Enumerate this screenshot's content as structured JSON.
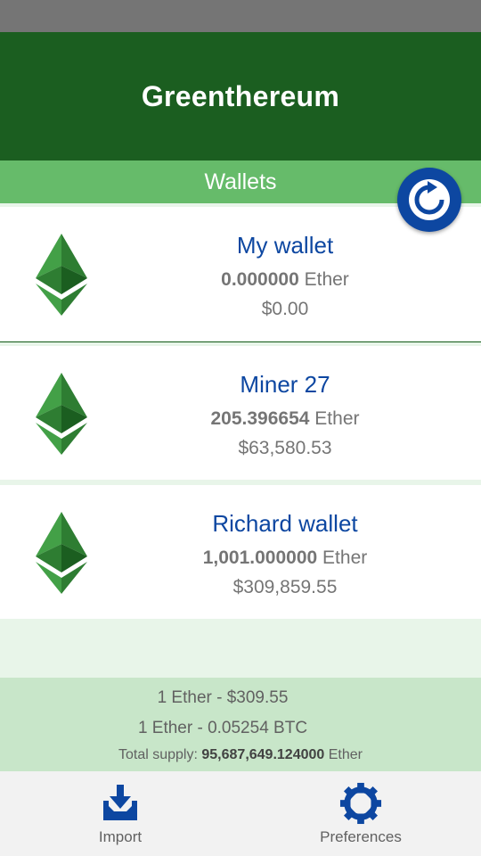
{
  "app": {
    "title": "Greenthereum"
  },
  "section": {
    "label": "Wallets"
  },
  "refresh": {
    "icon": "refresh-icon"
  },
  "wallets": [
    {
      "name": "My wallet",
      "balance": "0.000000",
      "unit": "Ether",
      "usd": "$0.00"
    },
    {
      "name": "Miner 27",
      "balance": "205.396654",
      "unit": "Ether",
      "usd": "$63,580.53"
    },
    {
      "name": "Richard wallet",
      "balance": "1,001.000000",
      "unit": "Ether",
      "usd": "$309,859.55"
    }
  ],
  "rates": {
    "usd": "1 Ether - $309.55",
    "btc": "1 Ether - 0.05254 BTC",
    "supply_label": "Total supply:",
    "supply_value": "95,687,649.124000",
    "supply_unit": "Ether"
  },
  "nav": {
    "import": {
      "label": "Import",
      "icon": "import-icon"
    },
    "preferences": {
      "label": "Preferences",
      "icon": "gear-icon"
    }
  },
  "colors": {
    "primary_dark": "#1b5e20",
    "primary_light": "#66bb6a",
    "accent": "#0d47a1",
    "background": "#e8f5e9",
    "rates_bg": "#c8e6c9"
  }
}
